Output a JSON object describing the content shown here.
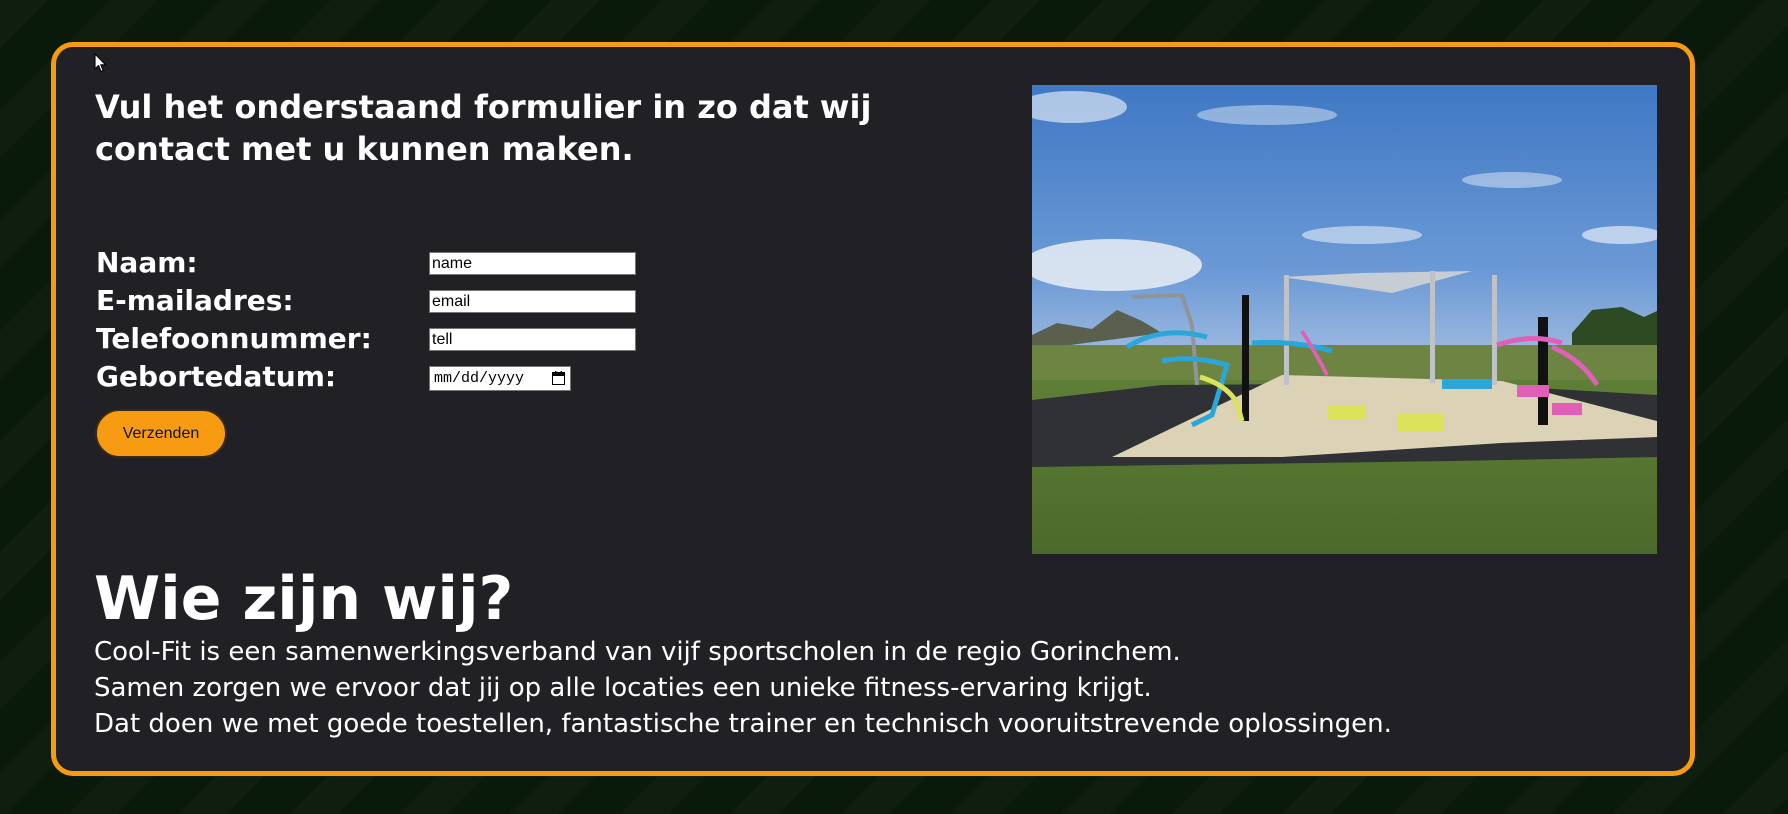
{
  "contact_form": {
    "title": "Vul het onderstaand formulier in zo dat wij contact met u kunnen maken.",
    "fields": [
      {
        "label": "Naam:",
        "value": "name"
      },
      {
        "label": "E-mailadres:",
        "value": "email"
      },
      {
        "label": "Telefoonnummer:",
        "value": "tell"
      },
      {
        "label": "Gebortedatum:",
        "placeholder": "mm/dd/yyyy"
      }
    ],
    "submit_label": "Verzenden"
  },
  "about": {
    "title": "Wie zijn wij?",
    "lines": [
      "Cool-Fit is een samenwerkingsverband van vijf sportscholen in de regio Gorinchem.",
      "Samen zorgen we ervoor dat jij op alle locaties een unieke fitness-ervaring krijgt.",
      "Dat doen we met goede toestellen, fantastische trainer en technisch vooruitstrevende oplossingen."
    ]
  },
  "icons": {
    "cursor": "mouse-pointer-icon",
    "date_picker": "calendar-icon"
  },
  "colors": {
    "page_background": "#0a1a0a",
    "card_background": "#212025",
    "accent": "#f79c12",
    "text": "#ffffff"
  }
}
